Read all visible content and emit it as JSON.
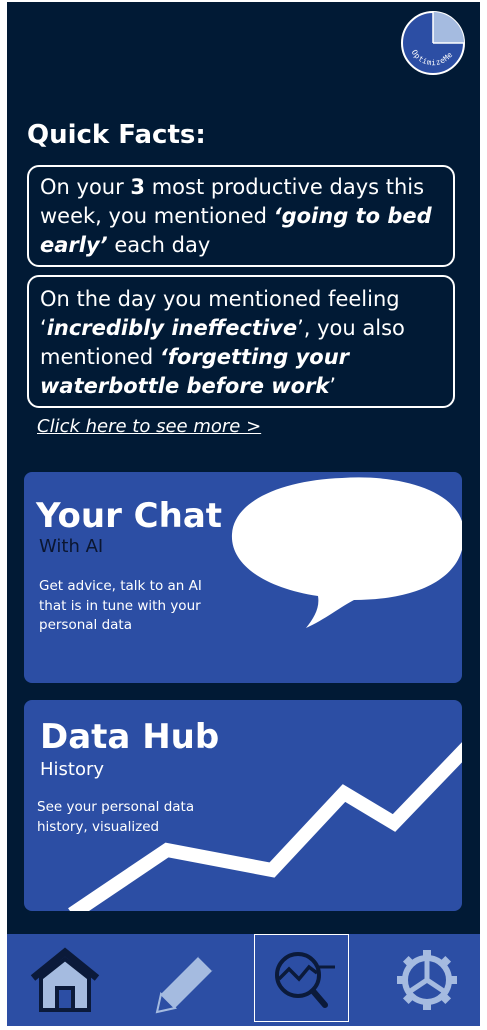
{
  "app": {
    "logo_text": "OptimizeMe",
    "colors": {
      "background": "#011a35",
      "card": "#2c4ea4",
      "text": "#ffffff",
      "icon_light": "#a5bbe0"
    }
  },
  "quick_facts": {
    "heading": "Quick Facts:",
    "fact1": {
      "p1": "On your ",
      "count": "3",
      "p2": " most productive days this week, you mentioned ",
      "phrase": "‘going to bed early’",
      "p3": " each day"
    },
    "fact2": {
      "p1": "On the day you mentioned feeling ‘",
      "phrase1": "incredibly ineffective",
      "p2": "’, you also mentioned ",
      "phrase2": "‘forgetting your waterbottle before work",
      "p3": "’"
    },
    "see_more": "Click here to see more >"
  },
  "chat_card": {
    "title": "Your Chat",
    "subtitle": "With AI",
    "description": "Get advice, talk to an AI that is in tune with your personal data"
  },
  "hub_card": {
    "title": "Data Hub",
    "subtitle": "History",
    "description": "See your personal data history, visualized"
  },
  "nav": {
    "items": [
      {
        "icon": "home-icon",
        "selected": false
      },
      {
        "icon": "pencil-icon",
        "selected": false
      },
      {
        "icon": "chart-search-icon",
        "selected": true
      },
      {
        "icon": "gear-icon",
        "selected": false
      }
    ]
  }
}
